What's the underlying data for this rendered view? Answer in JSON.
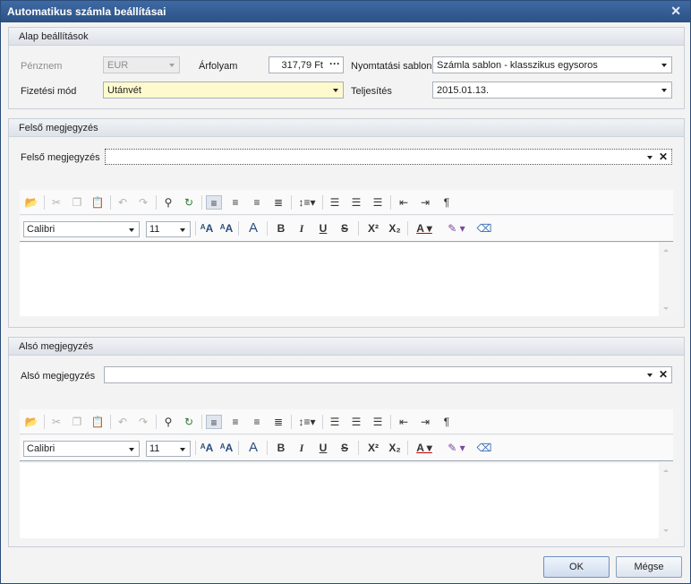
{
  "window": {
    "title": "Automatikus számla beállításai"
  },
  "basic": {
    "header": "Alap beállítások",
    "currency_label": "Pénznem",
    "currency_value": "EUR",
    "rate_label": "Árfolyam",
    "rate_value": "317,79 Ft",
    "print_template_label": "Nyomtatási sablon",
    "print_template_value": "Számla sablon - klasszikus egysoros",
    "payment_label": "Fizetési mód",
    "payment_value": "Utánvét",
    "fulfillment_label": "Teljesítés",
    "fulfillment_value": "2015.01.13."
  },
  "top_note": {
    "header": "Felső megjegyzés",
    "field_label": "Felső megjegyzés",
    "field_value": "",
    "font": "Calibri",
    "size": "11"
  },
  "bottom_note": {
    "header": "Alsó megjegyzés",
    "field_label": "Alsó megjegyzés",
    "field_value": "",
    "font": "Calibri",
    "size": "11"
  },
  "buttons": {
    "ok": "OK",
    "cancel": "Mégse"
  },
  "colors": {
    "title_bar": "#2c5186",
    "highlight": "#fffacd"
  }
}
